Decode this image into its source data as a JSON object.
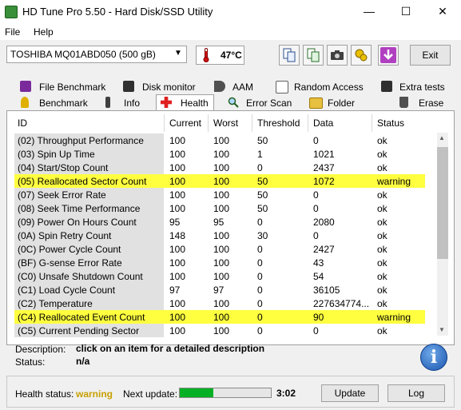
{
  "window": {
    "title": "HD Tune Pro 5.50 - Hard Disk/SSD Utility",
    "minimize": "—",
    "maximize": "☐",
    "close": "✕"
  },
  "menu": {
    "file": "File",
    "help": "Help"
  },
  "toolbar": {
    "drive": "TOSHIBA MQ01ABD050 (500 gB)",
    "temperature": "47°C",
    "exit_label": "Exit",
    "icons": [
      "copy-icon",
      "copy-info-icon",
      "camera-icon",
      "options-icon",
      "download-icon"
    ]
  },
  "tabs_top": [
    {
      "label": "File Benchmark",
      "icon": "file-benchmark-icon"
    },
    {
      "label": "Disk monitor",
      "icon": "disk-monitor-icon"
    },
    {
      "label": "AAM",
      "icon": "speaker-icon"
    },
    {
      "label": "Random Access",
      "icon": "random-access-icon"
    },
    {
      "label": "Extra tests",
      "icon": "extra-tests-icon"
    }
  ],
  "tabs_bottom": [
    {
      "label": "Benchmark",
      "icon": "benchmark-icon"
    },
    {
      "label": "Info",
      "icon": "info-icon"
    },
    {
      "label": "Health",
      "icon": "health-cross-icon",
      "active": true
    },
    {
      "label": "Error Scan",
      "icon": "magnifier-icon"
    },
    {
      "label": "Folder Usage",
      "icon": "folder-icon"
    },
    {
      "label": "Erase",
      "icon": "trash-icon"
    }
  ],
  "table": {
    "columns": [
      "ID",
      "Current",
      "Worst",
      "Threshold",
      "Data",
      "Status"
    ],
    "rows": [
      [
        "(02) Throughput Performance",
        "100",
        "100",
        "50",
        "0",
        "ok"
      ],
      [
        "(03) Spin Up Time",
        "100",
        "100",
        "1",
        "1021",
        "ok"
      ],
      [
        "(04) Start/Stop Count",
        "100",
        "100",
        "0",
        "2437",
        "ok"
      ],
      [
        "(05) Reallocated Sector Count",
        "100",
        "100",
        "50",
        "1072",
        "warning"
      ],
      [
        "(07) Seek Error Rate",
        "100",
        "100",
        "50",
        "0",
        "ok"
      ],
      [
        "(08) Seek Time Performance",
        "100",
        "100",
        "50",
        "0",
        "ok"
      ],
      [
        "(09) Power On Hours Count",
        "95",
        "95",
        "0",
        "2080",
        "ok"
      ],
      [
        "(0A) Spin Retry Count",
        "148",
        "100",
        "30",
        "0",
        "ok"
      ],
      [
        "(0C) Power Cycle Count",
        "100",
        "100",
        "0",
        "2427",
        "ok"
      ],
      [
        "(BF) G-sense Error Rate",
        "100",
        "100",
        "0",
        "43",
        "ok"
      ],
      [
        "(C0) Unsafe Shutdown Count",
        "100",
        "100",
        "0",
        "54",
        "ok"
      ],
      [
        "(C1) Load Cycle Count",
        "97",
        "97",
        "0",
        "36105",
        "ok"
      ],
      [
        "(C2) Temperature",
        "100",
        "100",
        "0",
        "227634774...",
        "ok"
      ],
      [
        "(C4) Reallocated Event Count",
        "100",
        "100",
        "0",
        "90",
        "warning"
      ],
      [
        "(C5) Current Pending Sector",
        "100",
        "100",
        "0",
        "0",
        "ok"
      ]
    ]
  },
  "details": {
    "description_label": "Description:",
    "description_value": "click on an item for a detailed description",
    "status_label": "Status:",
    "status_value": "n/a"
  },
  "footer": {
    "health_label": "Health status:",
    "health_value": "warning",
    "next_update_label": "Next update:",
    "next_update_progress": 0.37,
    "timer": "3:02",
    "update_button": "Update",
    "log_button": "Log"
  },
  "colors": {
    "warning_row": "#ffff40",
    "warning_text": "#c8a000",
    "progress_fill": "#06b025"
  }
}
